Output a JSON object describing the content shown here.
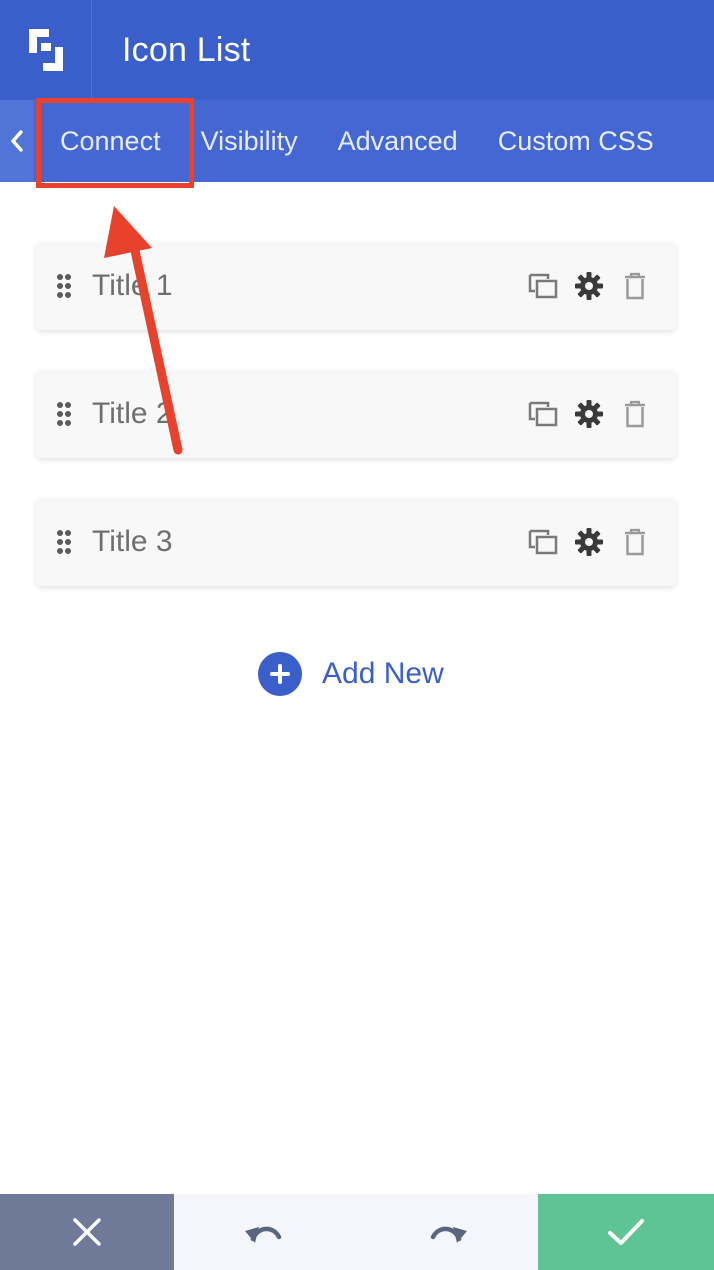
{
  "header": {
    "title": "Icon List",
    "logo_icon": "brand-logo-icon"
  },
  "tabs": {
    "back_icon": "chevron-left-icon",
    "items": [
      "Connect",
      "Visibility",
      "Advanced",
      "Custom CSS"
    ]
  },
  "list": {
    "items": [
      {
        "title": "Title 1"
      },
      {
        "title": "Title 2"
      },
      {
        "title": "Title 3"
      }
    ],
    "actions": [
      "duplicate-icon",
      "gear-icon",
      "trash-icon"
    ]
  },
  "add_new": {
    "label": "Add New",
    "icon": "plus-circle-icon"
  },
  "footer": {
    "cancel_icon": "close-icon",
    "undo_icon": "undo-icon",
    "redo_icon": "redo-icon",
    "confirm_icon": "checkmark-icon"
  },
  "colors": {
    "brand": "#3a5fcb",
    "tab_bar": "#4467d3",
    "annotation": "#e8412c",
    "cancel": "#6e7a97",
    "confirm": "#5fc494"
  }
}
